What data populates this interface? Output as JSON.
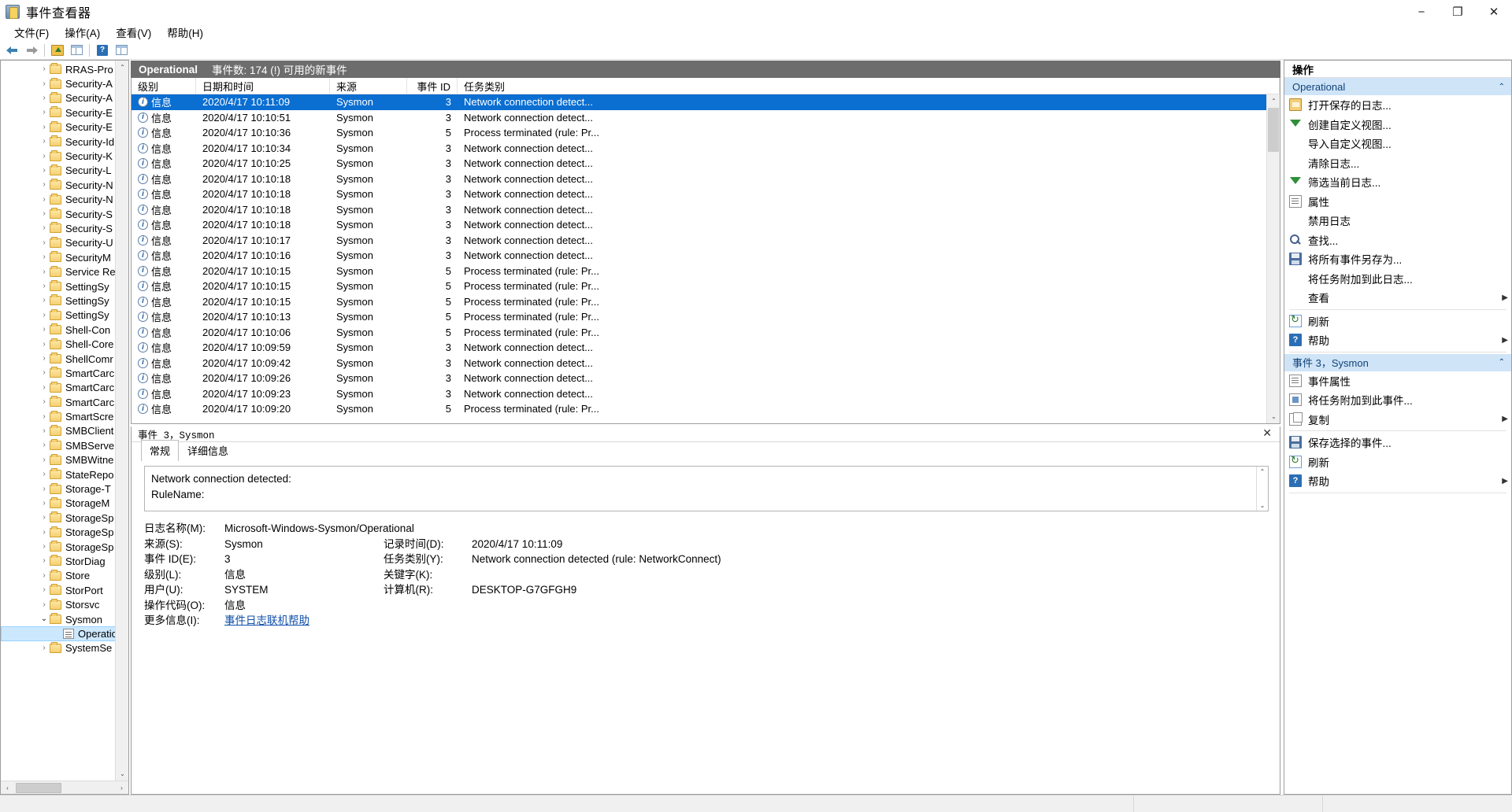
{
  "window": {
    "title": "事件查看器",
    "icon": "event-viewer-icon",
    "minimize": "−",
    "maximize": "❐",
    "close": "✕"
  },
  "menu": {
    "items": [
      {
        "label": "文件(F)"
      },
      {
        "label": "操作(A)"
      },
      {
        "label": "查看(V)"
      },
      {
        "label": "帮助(H)"
      }
    ]
  },
  "toolbar": {
    "buttons": [
      {
        "name": "back-icon",
        "label": ""
      },
      {
        "name": "forward-icon",
        "label": ""
      },
      {
        "name": "up-one-level-icon",
        "label": ""
      },
      {
        "name": "show-hide-tree-icon",
        "label": ""
      },
      {
        "name": "help-icon",
        "label": "?"
      },
      {
        "name": "show-hide-action-pane-icon",
        "label": ""
      }
    ]
  },
  "tree": {
    "items": [
      {
        "label": "RRAS-Pro",
        "twisty": "›",
        "level": 2
      },
      {
        "label": "Security-A",
        "twisty": "›",
        "level": 2
      },
      {
        "label": "Security-A",
        "twisty": "›",
        "level": 2
      },
      {
        "label": "Security-E",
        "twisty": "›",
        "level": 2
      },
      {
        "label": "Security-E",
        "twisty": "›",
        "level": 2
      },
      {
        "label": "Security-Id",
        "twisty": "›",
        "level": 2
      },
      {
        "label": "Security-K",
        "twisty": "›",
        "level": 2
      },
      {
        "label": "Security-L",
        "twisty": "›",
        "level": 2
      },
      {
        "label": "Security-N",
        "twisty": "›",
        "level": 2
      },
      {
        "label": "Security-N",
        "twisty": "›",
        "level": 2
      },
      {
        "label": "Security-S",
        "twisty": "›",
        "level": 2
      },
      {
        "label": "Security-S",
        "twisty": "›",
        "level": 2
      },
      {
        "label": "Security-U",
        "twisty": "›",
        "level": 2
      },
      {
        "label": "SecurityM",
        "twisty": "›",
        "level": 2
      },
      {
        "label": "Service Re",
        "twisty": "›",
        "level": 2
      },
      {
        "label": "SettingSy",
        "twisty": "›",
        "level": 2
      },
      {
        "label": "SettingSy",
        "twisty": "›",
        "level": 2
      },
      {
        "label": "SettingSy",
        "twisty": "›",
        "level": 2
      },
      {
        "label": "Shell-Con",
        "twisty": "›",
        "level": 2
      },
      {
        "label": "Shell-Core",
        "twisty": "›",
        "level": 2
      },
      {
        "label": "ShellComr",
        "twisty": "›",
        "level": 2
      },
      {
        "label": "SmartCarc",
        "twisty": "›",
        "level": 2
      },
      {
        "label": "SmartCarc",
        "twisty": "›",
        "level": 2
      },
      {
        "label": "SmartCarc",
        "twisty": "›",
        "level": 2
      },
      {
        "label": "SmartScre",
        "twisty": "›",
        "level": 2
      },
      {
        "label": "SMBClient",
        "twisty": "›",
        "level": 2
      },
      {
        "label": "SMBServe",
        "twisty": "›",
        "level": 2
      },
      {
        "label": "SMBWitne",
        "twisty": "›",
        "level": 2
      },
      {
        "label": "StateRepo",
        "twisty": "›",
        "level": 2
      },
      {
        "label": "Storage-T",
        "twisty": "›",
        "level": 2
      },
      {
        "label": "StorageM",
        "twisty": "›",
        "level": 2
      },
      {
        "label": "StorageSp",
        "twisty": "›",
        "level": 2
      },
      {
        "label": "StorageSp",
        "twisty": "›",
        "level": 2
      },
      {
        "label": "StorageSp",
        "twisty": "›",
        "level": 2
      },
      {
        "label": "StorDiag",
        "twisty": "›",
        "level": 2
      },
      {
        "label": "Store",
        "twisty": "›",
        "level": 2
      },
      {
        "label": "StorPort",
        "twisty": "›",
        "level": 2
      },
      {
        "label": "Storsvc",
        "twisty": "›",
        "level": 2
      },
      {
        "label": "Sysmon",
        "twisty": "⌄",
        "level": 2,
        "expanded": true
      },
      {
        "label": "Operatio",
        "twisty": "",
        "level": 3,
        "selected": true,
        "icon": "log-icon"
      },
      {
        "label": "SystemSe",
        "twisty": "›",
        "level": 2
      }
    ]
  },
  "log": {
    "header": {
      "name": "Operational",
      "count_text": "事件数: 174 (!) 可用的新事件"
    },
    "columns": [
      "级别",
      "日期和时间",
      "来源",
      "事件 ID",
      "任务类别"
    ],
    "rows": [
      {
        "level": "信息",
        "date": "2020/4/17 10:11:09",
        "source": "Sysmon",
        "eid": "3",
        "task": "Network connection detect...",
        "selected": true
      },
      {
        "level": "信息",
        "date": "2020/4/17 10:10:51",
        "source": "Sysmon",
        "eid": "3",
        "task": "Network connection detect..."
      },
      {
        "level": "信息",
        "date": "2020/4/17 10:10:36",
        "source": "Sysmon",
        "eid": "5",
        "task": "Process terminated (rule: Pr..."
      },
      {
        "level": "信息",
        "date": "2020/4/17 10:10:34",
        "source": "Sysmon",
        "eid": "3",
        "task": "Network connection detect..."
      },
      {
        "level": "信息",
        "date": "2020/4/17 10:10:25",
        "source": "Sysmon",
        "eid": "3",
        "task": "Network connection detect..."
      },
      {
        "level": "信息",
        "date": "2020/4/17 10:10:18",
        "source": "Sysmon",
        "eid": "3",
        "task": "Network connection detect..."
      },
      {
        "level": "信息",
        "date": "2020/4/17 10:10:18",
        "source": "Sysmon",
        "eid": "3",
        "task": "Network connection detect..."
      },
      {
        "level": "信息",
        "date": "2020/4/17 10:10:18",
        "source": "Sysmon",
        "eid": "3",
        "task": "Network connection detect..."
      },
      {
        "level": "信息",
        "date": "2020/4/17 10:10:18",
        "source": "Sysmon",
        "eid": "3",
        "task": "Network connection detect..."
      },
      {
        "level": "信息",
        "date": "2020/4/17 10:10:17",
        "source": "Sysmon",
        "eid": "3",
        "task": "Network connection detect..."
      },
      {
        "level": "信息",
        "date": "2020/4/17 10:10:16",
        "source": "Sysmon",
        "eid": "3",
        "task": "Network connection detect..."
      },
      {
        "level": "信息",
        "date": "2020/4/17 10:10:15",
        "source": "Sysmon",
        "eid": "5",
        "task": "Process terminated (rule: Pr..."
      },
      {
        "level": "信息",
        "date": "2020/4/17 10:10:15",
        "source": "Sysmon",
        "eid": "5",
        "task": "Process terminated (rule: Pr..."
      },
      {
        "level": "信息",
        "date": "2020/4/17 10:10:15",
        "source": "Sysmon",
        "eid": "5",
        "task": "Process terminated (rule: Pr..."
      },
      {
        "level": "信息",
        "date": "2020/4/17 10:10:13",
        "source": "Sysmon",
        "eid": "5",
        "task": "Process terminated (rule: Pr..."
      },
      {
        "level": "信息",
        "date": "2020/4/17 10:10:06",
        "source": "Sysmon",
        "eid": "5",
        "task": "Process terminated (rule: Pr..."
      },
      {
        "level": "信息",
        "date": "2020/4/17 10:09:59",
        "source": "Sysmon",
        "eid": "3",
        "task": "Network connection detect..."
      },
      {
        "level": "信息",
        "date": "2020/4/17 10:09:42",
        "source": "Sysmon",
        "eid": "3",
        "task": "Network connection detect..."
      },
      {
        "level": "信息",
        "date": "2020/4/17 10:09:26",
        "source": "Sysmon",
        "eid": "3",
        "task": "Network connection detect..."
      },
      {
        "level": "信息",
        "date": "2020/4/17 10:09:23",
        "source": "Sysmon",
        "eid": "3",
        "task": "Network connection detect..."
      },
      {
        "level": "信息",
        "date": "2020/4/17 10:09:20",
        "source": "Sysmon",
        "eid": "5",
        "task": "Process terminated (rule: Pr..."
      }
    ]
  },
  "detail": {
    "title": "事件 3，Sysmon",
    "close": "✕",
    "tabs": [
      {
        "label": "常规",
        "active": true
      },
      {
        "label": "详细信息",
        "active": false
      }
    ],
    "description": "Network connection detected:\nRuleName:",
    "fields": {
      "log_name_label": "日志名称(M):",
      "log_name_value": "Microsoft-Windows-Sysmon/Operational",
      "source_label": "来源(S):",
      "source_value": "Sysmon",
      "logged_label": "记录时间(D):",
      "logged_value": "2020/4/17 10:11:09",
      "event_id_label": "事件 ID(E):",
      "event_id_value": "3",
      "task_label": "任务类别(Y):",
      "task_value": "Network connection detected (rule: NetworkConnect)",
      "level_label": "级别(L):",
      "level_value": "信息",
      "keywords_label": "关键字(K):",
      "keywords_value": "",
      "user_label": "用户(U):",
      "user_value": "SYSTEM",
      "computer_label": "计算机(R):",
      "computer_value": "DESKTOP-G7GFGH9",
      "opcode_label": "操作代码(O):",
      "opcode_value": "信息",
      "more_info_label": "更多信息(I):",
      "more_info_link": "事件日志联机帮助"
    }
  },
  "actions": {
    "title": "操作",
    "groups": [
      {
        "name": "Operational",
        "chevron": "⌃",
        "items": [
          {
            "label": "打开保存的日志...",
            "icon": "open-log-icon",
            "submenu": false
          },
          {
            "label": "创建自定义视图...",
            "icon": "create-view-icon",
            "submenu": false
          },
          {
            "label": "导入自定义视图...",
            "icon": "blank-icon",
            "submenu": false
          },
          {
            "label": "清除日志...",
            "icon": "blank-icon",
            "submenu": false
          },
          {
            "label": "筛选当前日志...",
            "icon": "filter-icon",
            "submenu": false
          },
          {
            "label": "属性",
            "icon": "properties-icon",
            "submenu": false
          },
          {
            "label": "禁用日志",
            "icon": "blank-icon",
            "submenu": false
          },
          {
            "label": "查找...",
            "icon": "find-icon",
            "submenu": false
          },
          {
            "label": "将所有事件另存为...",
            "icon": "save-icon",
            "submenu": false
          },
          {
            "label": "将任务附加到此日志...",
            "icon": "blank-icon",
            "submenu": false
          },
          {
            "label": "查看",
            "icon": "blank-icon",
            "submenu": true
          },
          {
            "label": "刷新",
            "icon": "refresh-icon",
            "submenu": false
          },
          {
            "label": "帮助",
            "icon": "help-icon",
            "submenu": true
          }
        ]
      },
      {
        "name": "事件 3，Sysmon",
        "chevron": "⌃",
        "items": [
          {
            "label": "事件属性",
            "icon": "properties-icon",
            "submenu": false
          },
          {
            "label": "将任务附加到此事件...",
            "icon": "attach-task-icon",
            "submenu": false
          },
          {
            "label": "复制",
            "icon": "copy-icon",
            "submenu": true
          },
          {
            "label": "保存选择的事件...",
            "icon": "save-icon",
            "submenu": false
          },
          {
            "label": "刷新",
            "icon": "refresh-icon",
            "submenu": false
          },
          {
            "label": "帮助",
            "icon": "help-icon",
            "submenu": true
          }
        ]
      }
    ]
  },
  "scrollbars": {
    "up_arrow": "⌃",
    "down_arrow": "⌄",
    "left_arrow": "‹",
    "right_arrow": "›"
  }
}
